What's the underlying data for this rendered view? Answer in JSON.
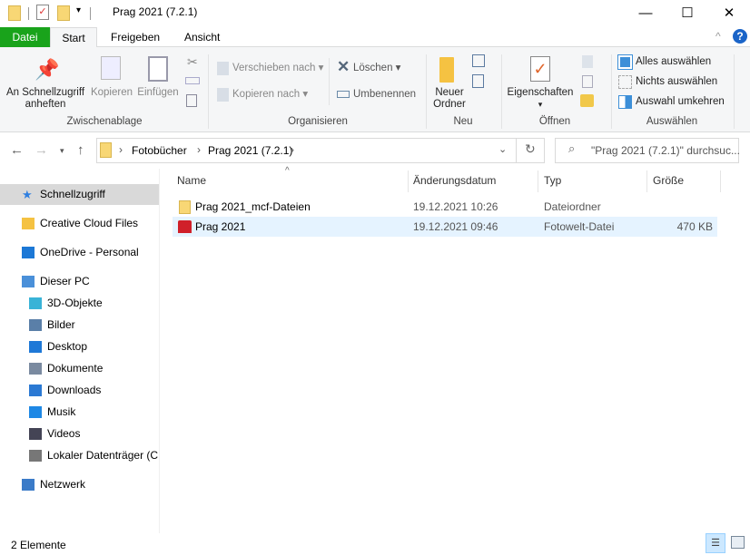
{
  "window": {
    "title": "Prag 2021 (7.2.1)",
    "minimize": "—",
    "maximize": "☐",
    "close": "✕"
  },
  "ribbon_tabs": [
    "Datei",
    "Start",
    "Freigeben",
    "Ansicht"
  ],
  "ribbon": {
    "clipboard": {
      "pin": "An Schnellzugriff anheften",
      "pin1": "An Schnellzugriff",
      "pin2": "anheften",
      "copy": "Kopieren",
      "paste": "Einfügen",
      "label": "Zwischenablage"
    },
    "organize": {
      "move": "Verschieben nach",
      "copy_to": "Kopieren nach",
      "delete": "Löschen",
      "rename": "Umbenennen",
      "label": "Organisieren"
    },
    "new": {
      "new_folder1": "Neuer",
      "new_folder2": "Ordner",
      "label": "Neu"
    },
    "open": {
      "properties": "Eigenschaften",
      "label": "Öffnen"
    },
    "select": {
      "all": "Alles auswählen",
      "none": "Nichts auswählen",
      "invert": "Auswahl umkehren",
      "label": "Auswählen"
    }
  },
  "address": {
    "crumbs": [
      "Fotobücher",
      "Prag 2021 (7.2.1)"
    ]
  },
  "search": {
    "placeholder": "\"Prag 2021 (7.2.1)\" durchsuc..."
  },
  "sidebar": [
    {
      "label": "Schnellzugriff",
      "icon": "star-icon"
    },
    {
      "label": "Creative Cloud Files",
      "icon": "creative-cloud-icon"
    },
    {
      "label": "OneDrive - Personal",
      "icon": "cloud-icon"
    },
    {
      "label": "Dieser PC",
      "icon": "computer-icon"
    },
    {
      "label": "3D-Objekte",
      "icon": "cube-icon"
    },
    {
      "label": "Bilder",
      "icon": "pictures-icon"
    },
    {
      "label": "Desktop",
      "icon": "desktop-icon"
    },
    {
      "label": "Dokumente",
      "icon": "documents-icon"
    },
    {
      "label": "Downloads",
      "icon": "download-icon"
    },
    {
      "label": "Musik",
      "icon": "music-icon"
    },
    {
      "label": "Videos",
      "icon": "video-icon"
    },
    {
      "label": "Lokaler Datenträger (C:)",
      "icon": "drive-icon"
    },
    {
      "label": "Netzwerk",
      "icon": "network-icon"
    }
  ],
  "columns": {
    "name": "Name",
    "date": "Änderungsdatum",
    "type": "Typ",
    "size": "Größe"
  },
  "files": [
    {
      "name": "Prag 2021_mcf-Dateien",
      "date": "19.12.2021 10:26",
      "type": "Dateiordner",
      "size": ""
    },
    {
      "name": "Prag 2021",
      "date": "19.12.2021 09:46",
      "type": "Fotowelt-Datei",
      "size": "470 KB"
    }
  ],
  "status": {
    "count": "2 Elemente"
  },
  "colors": {
    "datei": "#19a31b",
    "selection": "#e5f3ff",
    "hover": "#d9d9d9"
  }
}
